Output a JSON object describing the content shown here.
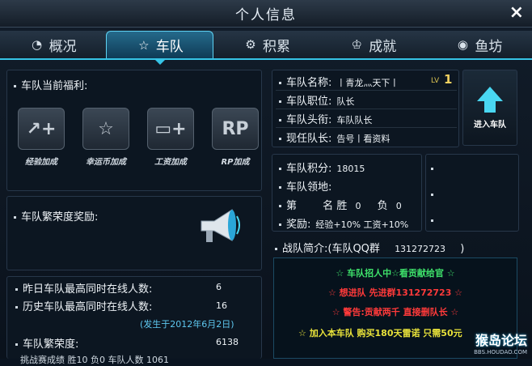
{
  "window": {
    "title": "个人信息",
    "close": "×"
  },
  "tabs": [
    {
      "label": "概况",
      "icon": "gauge-icon"
    },
    {
      "label": "车队",
      "icon": "star-icon"
    },
    {
      "label": "积累",
      "icon": "gear-icon"
    },
    {
      "label": "成就",
      "icon": "award-icon"
    },
    {
      "label": "鱼坊",
      "icon": "fish-icon"
    }
  ],
  "benefits": {
    "title": "车队当前福利:",
    "items": [
      {
        "label": "经验加成",
        "glyph": "↗+"
      },
      {
        "label": "幸运币加成",
        "glyph": "☆"
      },
      {
        "label": "工资加成",
        "glyph": "▭+"
      },
      {
        "label": "RP加成",
        "glyph": "RP"
      }
    ]
  },
  "reward": {
    "title": "车队繁荣度奖励:"
  },
  "stats": {
    "yesterday_label": "昨日车队最高同时在线人数:",
    "yesterday_value": "6",
    "history_label": "历史车队最高同时在线人数:",
    "history_value": "16",
    "history_date": "(发生于2012年6月2日)",
    "prosperity_label": "车队繁荣度:",
    "prosperity_value": "6138",
    "cut_line": "挑战赛成绩 胜10 负0     车队人数 1061"
  },
  "team_info": {
    "name_label": "车队名称:",
    "name_value": "丨青龙灬天下丨",
    "lv_label": "LV",
    "lv_value": "1",
    "position_label": "车队职位:",
    "position_value": "队长",
    "title_label": "车队头衔:",
    "title_value": "车队队长",
    "leader_label": "现任队长:",
    "leader_value": "告号丨看资料"
  },
  "join_button": {
    "label": "进入车队"
  },
  "points": {
    "score_label": "车队积分:",
    "score_value": "18015",
    "territory_label": "车队领地:",
    "rank_label": "第",
    "rank_suffix": "名",
    "win_label": "胜",
    "win_value": "0",
    "loss_label": "负",
    "loss_value": "0",
    "bonus_label": "奖励:",
    "bonus_value": "经验+10% 工资+10%"
  },
  "intro": {
    "title": "战队简介:(车队QQ群",
    "qq": "131272723",
    "close_paren": ")",
    "lines": [
      {
        "text": "☆  车队招人中☆看贡献给官  ☆",
        "color": "#3ee06a"
      },
      {
        "text": "☆  想进队   先进群131272723  ☆",
        "color": "#ff3a3a"
      },
      {
        "text": "☆  警告:贡献两千 直接删队长  ☆",
        "color": "#ff3a3a"
      },
      {
        "text": "☆  加入本车队 购买180天雷诺 只需50元",
        "color": "#e8e23a"
      }
    ]
  },
  "watermark": {
    "main": "猴岛论坛",
    "sub": "BBS.HOUDAO.COM"
  }
}
